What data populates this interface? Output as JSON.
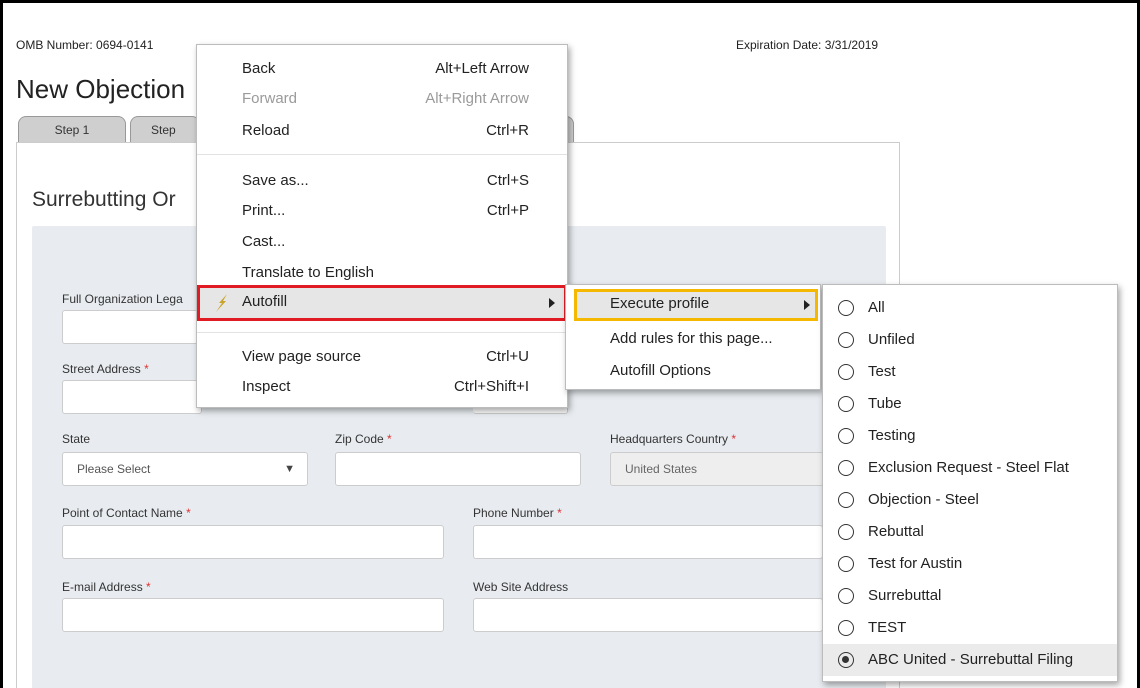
{
  "header": {
    "omb": "OMB Number: 0694-0141",
    "expiration": "Expiration Date: 3/31/2019",
    "title": "New Objection",
    "tabs": [
      "Step 1",
      "Step"
    ]
  },
  "form": {
    "section_title": "Surrebutting Or",
    "fields": {
      "org_label": "Full Organization Lega",
      "street_label": "Street Address",
      "state_label": "State",
      "state_value": "Please Select",
      "zip_label": "Zip Code",
      "hq_label": "Headquarters Country",
      "hq_value": "United States",
      "poc_label": "Point of Contact Name",
      "phone_label": "Phone Number",
      "email_label": "E-mail Address",
      "website_label": "Web Site Address"
    },
    "required_marker": "*"
  },
  "context_menu": {
    "items": [
      {
        "label": "Back",
        "shortcut": "Alt+Left Arrow"
      },
      {
        "label": "Forward",
        "shortcut": "Alt+Right Arrow"
      },
      {
        "label": "Reload",
        "shortcut": "Ctrl+R"
      },
      {
        "label": "Save as...",
        "shortcut": "Ctrl+S"
      },
      {
        "label": "Print...",
        "shortcut": "Ctrl+P"
      },
      {
        "label": "Cast...",
        "shortcut": ""
      },
      {
        "label": "Translate to English",
        "shortcut": ""
      },
      {
        "label": "Autofill",
        "shortcut": ""
      },
      {
        "label": "View page source",
        "shortcut": "Ctrl+U"
      },
      {
        "label": "Inspect",
        "shortcut": "Ctrl+Shift+I"
      }
    ]
  },
  "autofill_menu": {
    "items": [
      "Execute profile",
      "Add rules for this page...",
      "Autofill Options"
    ]
  },
  "profiles": {
    "items": [
      "All",
      "Unfiled",
      "Test",
      "Tube",
      "Testing",
      "Exclusion Request - Steel Flat",
      "Objection - Steel",
      "Rebuttal",
      "Test for Austin",
      "Surrebuttal",
      "TEST",
      "ABC United - Surrebuttal Filing"
    ],
    "selected": "ABC United - Surrebuttal Filing"
  },
  "colors": {
    "selected_outline": "#e01b24",
    "submenu_outline": "#f5b800",
    "required": "#dd3333"
  }
}
